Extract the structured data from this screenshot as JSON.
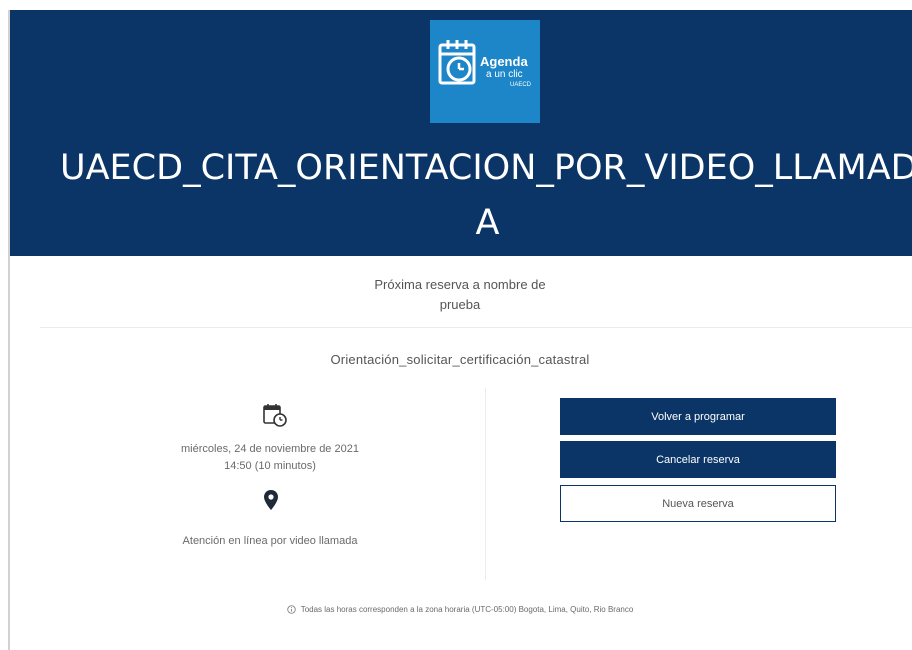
{
  "header": {
    "logo": {
      "line1": "Agenda",
      "line2": "a un clic",
      "line3": "UAECD",
      "icon": "calendar-clock-icon",
      "background_color": "#1d86c8"
    },
    "service_title_line1": "UAECD_CITA_ORIENTACION_POR_VIDEO_LLAMAD",
    "service_title_line2": "A",
    "background_color": "#0b3566"
  },
  "booking": {
    "next_booking_line1": "Próxima reserva a nombre de",
    "next_booking_line2": "prueba",
    "service_name": "Orientación_solicitar_certificación_catastral",
    "date": "miércoles, 24 de noviembre de 2021",
    "time": "14:50 (10 minutos)",
    "location": "Atención en línea por video llamada",
    "date_icon": "calendar-clock-icon",
    "location_icon": "map-pin-icon"
  },
  "actions": {
    "reschedule_label": "Volver a programar",
    "cancel_label": "Cancelar reserva",
    "new_label": "Nueva reserva"
  },
  "footer": {
    "timezone_note": "Todas las horas corresponden a la zona horaria (UTC-05:00) Bogota, Lima, Quito, Rio Branco",
    "icon": "info-circle-icon"
  }
}
